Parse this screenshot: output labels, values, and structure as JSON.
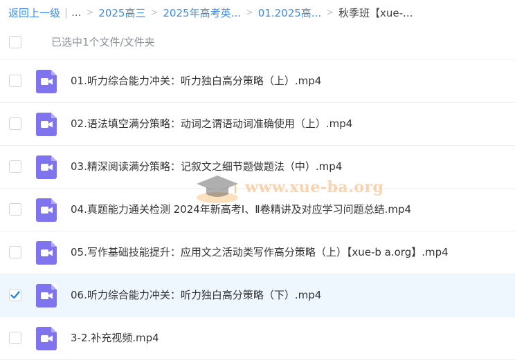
{
  "breadcrumb": {
    "back": "返回上一级",
    "ellipsis": "...",
    "items": [
      "2025高三",
      "2025年高考英...",
      "01.2025高..."
    ],
    "current": "秋季班【xue-..."
  },
  "header": {
    "selection_text": "已选中1个文件/文件夹"
  },
  "files": [
    {
      "name": "01.听力综合能力冲关：听力独白高分策略（上）.mp4",
      "selected": false,
      "icon": "video-file-icon"
    },
    {
      "name": "02.语法填空满分策略：动词之谓语动词准确使用（上）.mp4",
      "selected": false,
      "icon": "video-file-icon"
    },
    {
      "name": "03.精深阅读满分策略：记叙文之细节题做题法（中）.mp4",
      "selected": false,
      "icon": "video-file-icon"
    },
    {
      "name": "04.真题能力通关检测 2024年新高考Ⅰ、Ⅱ卷精讲及对应学习问题总结.mp4",
      "selected": false,
      "icon": "video-file-icon"
    },
    {
      "name": "05.写作基础技能提升：应用文之活动类写作高分策略（上）【xue-b a.org】.mp4",
      "selected": false,
      "icon": "video-file-icon"
    },
    {
      "name": "06.听力综合能力冲关：听力独白高分策略（下）.mp4",
      "selected": true,
      "icon": "video-file-icon"
    },
    {
      "name": "3-2.补充视频.mp4",
      "selected": false,
      "icon": "video-file-icon"
    }
  ],
  "watermark": {
    "text": "www.xue-ba.org",
    "icon": "graduation-cap-icon"
  },
  "colors": {
    "link": "#3b8cf0",
    "selected_row": "#eef6fe",
    "video_icon": "#7f73ee",
    "check": "#1e88e5"
  }
}
